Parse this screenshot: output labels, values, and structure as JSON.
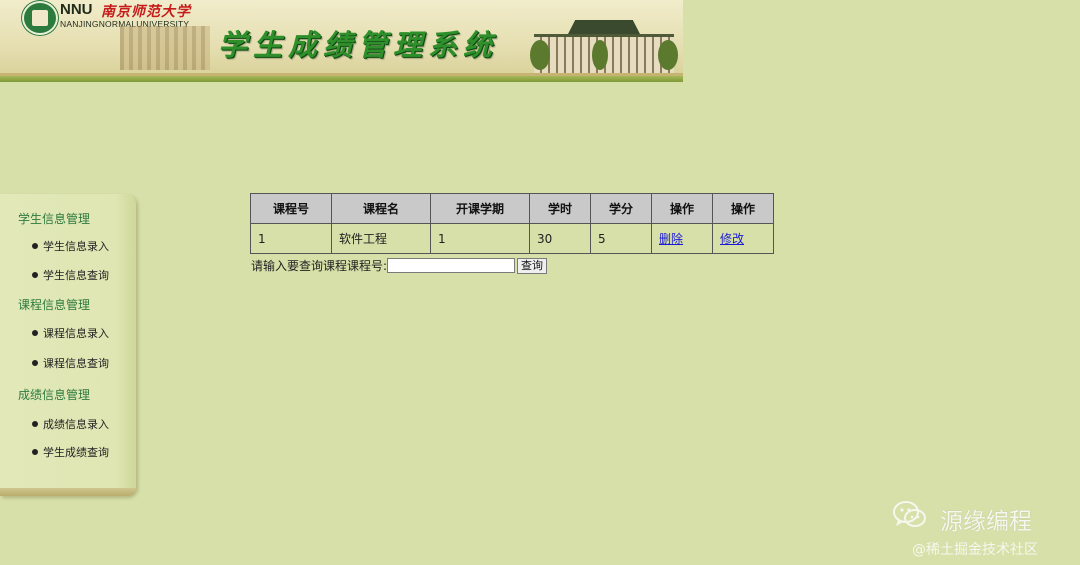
{
  "header": {
    "logo_abbr": "NNU",
    "logo_cn": "南京师范大学",
    "logo_en": "NANJINGNORMALUNIVERSITY",
    "system_title": "学生成绩管理系统"
  },
  "sidebar": {
    "sections": [
      {
        "title": "学生信息管理",
        "items": [
          "学生信息录入",
          "学生信息查询"
        ]
      },
      {
        "title": "课程信息管理",
        "items": [
          "课程信息录入",
          "课程信息查询"
        ]
      },
      {
        "title": "成绩信息管理",
        "items": [
          "成绩信息录入",
          "学生成绩查询"
        ]
      }
    ]
  },
  "table": {
    "headers": [
      "课程号",
      "课程名",
      "开课学期",
      "学时",
      "学分",
      "操作",
      "操作"
    ],
    "rows": [
      {
        "course_id": "1",
        "course_name": "软件工程",
        "semester": "1",
        "hours": "30",
        "credits": "5",
        "delete": "删除",
        "edit": "修改"
      }
    ]
  },
  "search": {
    "label": "请输入要查询课程课程号:",
    "value": "",
    "button": "查询"
  },
  "watermark": {
    "title": "源缘编程",
    "sub": "@稀土掘金技术社区",
    "icon": "wechat-icon"
  }
}
